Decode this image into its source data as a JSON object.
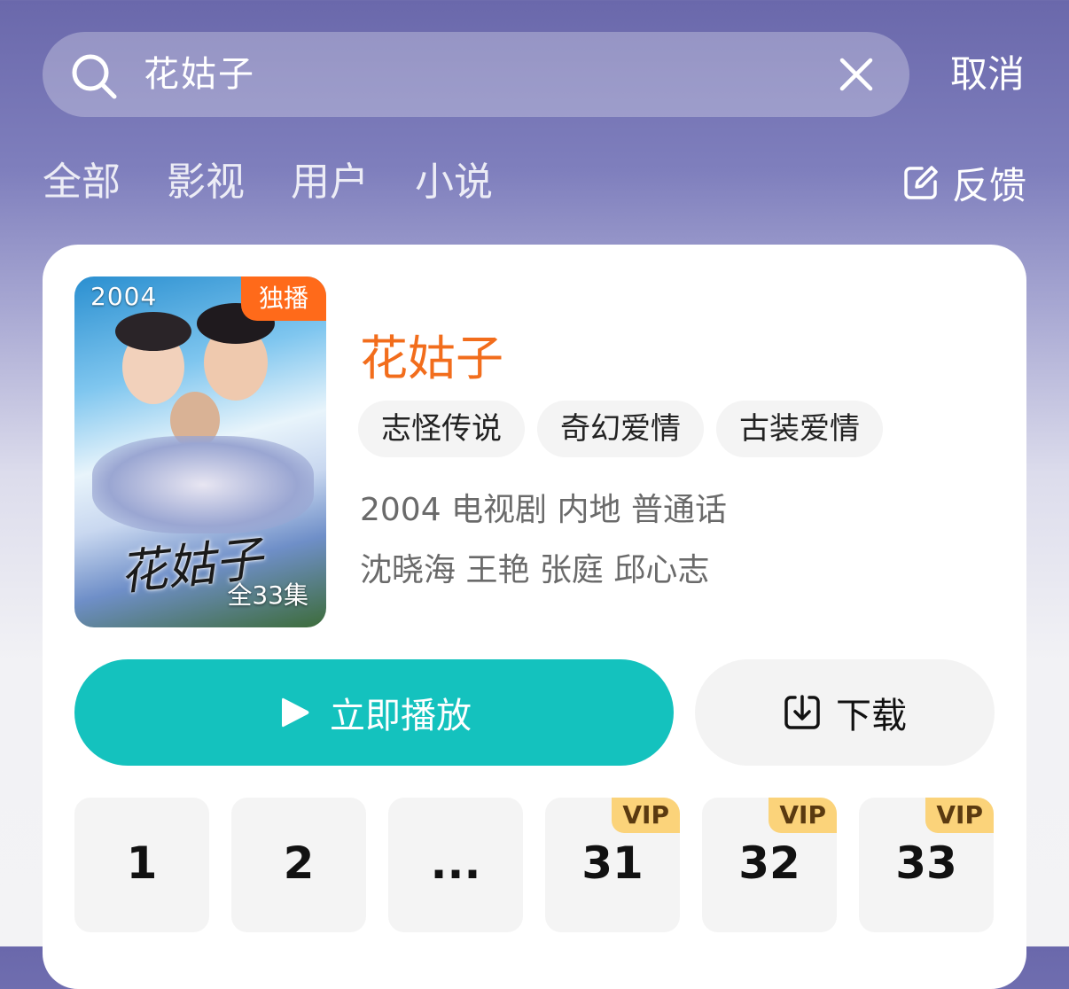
{
  "search": {
    "query": "花姑子",
    "cancel_label": "取消"
  },
  "tabs": [
    {
      "label": "全部"
    },
    {
      "label": "影视"
    },
    {
      "label": "用户"
    },
    {
      "label": "小说"
    }
  ],
  "feedback": {
    "label": "反馈",
    "icon": "edit-icon"
  },
  "result": {
    "poster": {
      "year": "2004",
      "badge": "独播",
      "title_art": "花姑子",
      "episodes_label": "全33集"
    },
    "title": "花姑子",
    "tags": [
      "志怪传说",
      "奇幻爱情",
      "古装爱情"
    ],
    "meta": "2004 电视剧 内地 普通话",
    "cast": "沈晓海 王艳 张庭 邱心志",
    "play_label": "立即播放",
    "download_label": "下载",
    "episodes": [
      {
        "num": "1",
        "vip": ""
      },
      {
        "num": "2",
        "vip": ""
      },
      {
        "num": "...",
        "vip": ""
      },
      {
        "num": "31",
        "vip": "VIP"
      },
      {
        "num": "32",
        "vip": "VIP"
      },
      {
        "num": "33",
        "vip": "VIP"
      }
    ]
  },
  "colors": {
    "accent": "#14c2be",
    "title": "#f26d1c",
    "badge": "#ff6a1a",
    "vip": "#fbd37a"
  }
}
